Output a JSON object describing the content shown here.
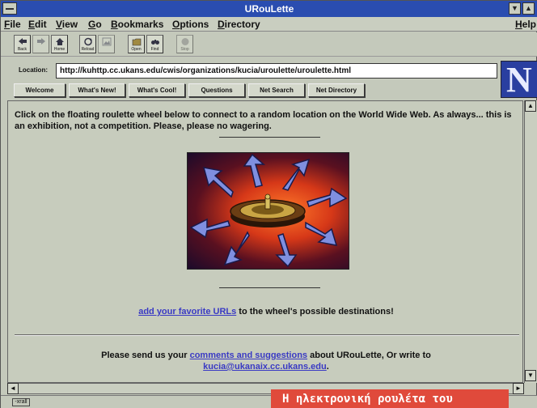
{
  "window": {
    "title": "URouLette"
  },
  "menu": {
    "items": [
      {
        "u": "F",
        "rest": "ile"
      },
      {
        "u": "E",
        "rest": "dit"
      },
      {
        "u": "V",
        "rest": "iew"
      },
      {
        "u": "G",
        "rest": "o"
      },
      {
        "u": "B",
        "rest": "ookmarks"
      },
      {
        "u": "O",
        "rest": "ptions"
      },
      {
        "u": "D",
        "rest": "irectory"
      }
    ],
    "help": {
      "u": "H",
      "rest": "elp"
    }
  },
  "toolbar": {
    "back": "Back",
    "forward": "",
    "home": "Home",
    "reload": "Reload",
    "images": "",
    "open": "Open",
    "find": "Find",
    "stop": "Stop"
  },
  "location": {
    "label": "Location:",
    "url": "http://kuhttp.cc.ukans.edu/cwis/organizations/kucia/uroulette/uroulette.html"
  },
  "logo": {
    "letter": "N"
  },
  "directory_buttons": [
    "Welcome",
    "What's New!",
    "What's Cool!",
    "Questions",
    "Net Search",
    "Net Directory"
  ],
  "content": {
    "intro": "Click on the floating roulette wheel below to connect to a random location on the World Wide Web. As always... this is an exhibition, not a competition. Please, please no wagering.",
    "add_link": "add your favorite URLs",
    "add_rest": " to the wheel's possible destinations!",
    "send_pre": "Please send us your ",
    "send_link": "comments and suggestions",
    "send_post": " about URouLette, Or write to",
    "email": "kucia@ukanaix.cc.ukans.edu",
    "email_post": "."
  },
  "status": {
    "key": "-xrall"
  },
  "caption": {
    "text": "Η ηλεκτρονική ρουλέτα του"
  },
  "colors": {
    "title_bar": "#2a4db0",
    "link": "#3a3ac4",
    "caption_bg": "#e04a3b"
  }
}
